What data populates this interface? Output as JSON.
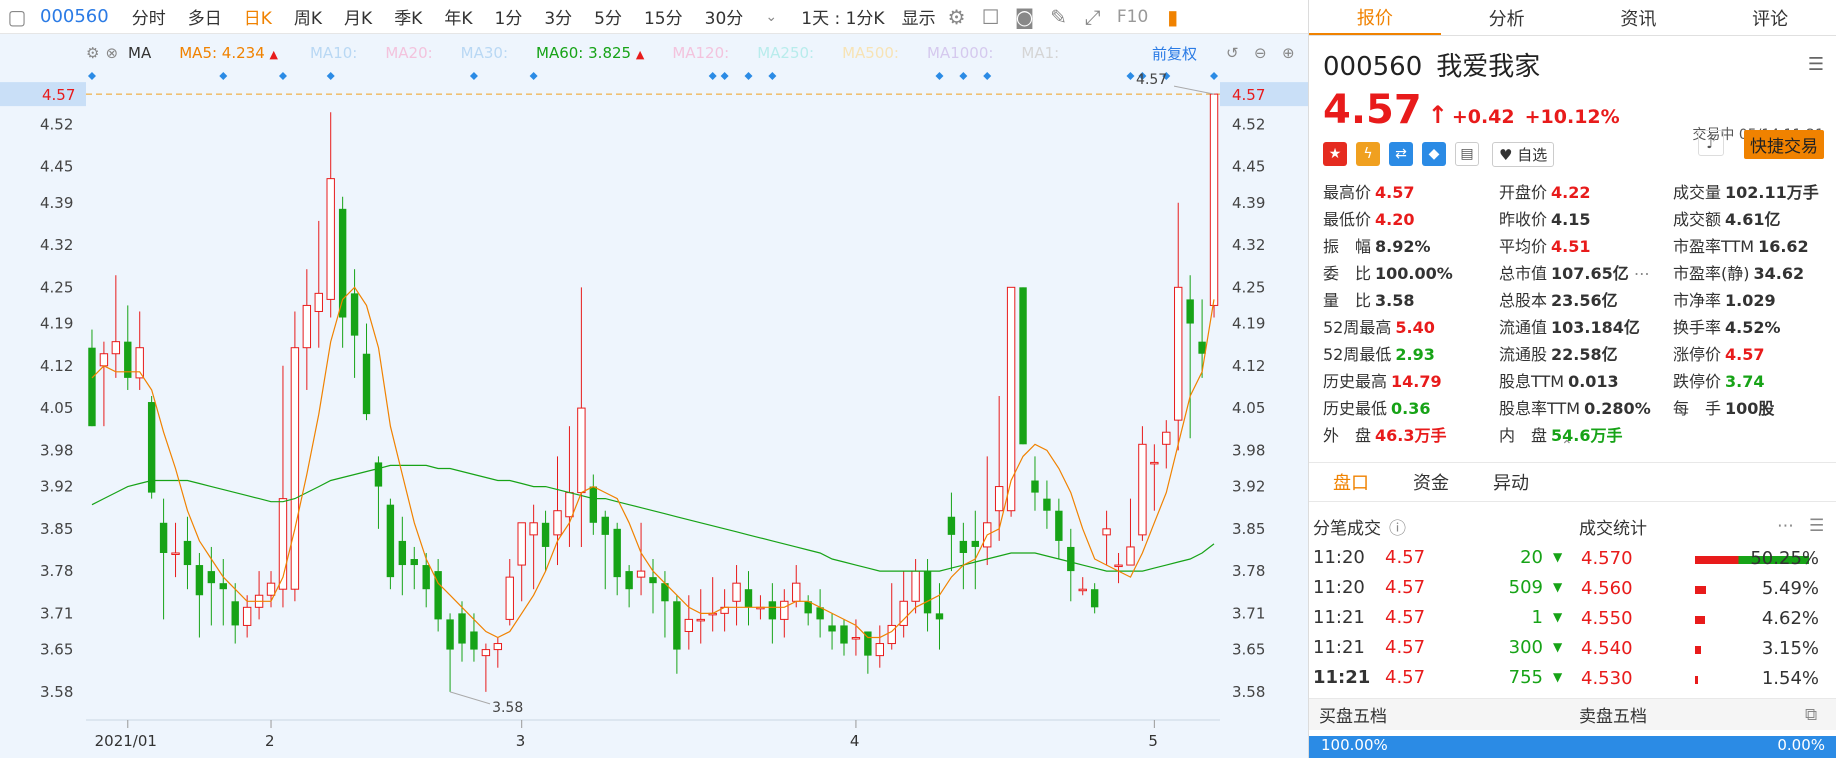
{
  "toolbar": {
    "code": "000560",
    "tabs": [
      "分时",
      "多日",
      "日K",
      "周K",
      "月K",
      "季K",
      "年K",
      "1分",
      "3分",
      "5分",
      "15分",
      "30分"
    ],
    "active_tab": "日K",
    "speed": "1天 : 1分K",
    "display": "显示",
    "f10": "F10"
  },
  "ma_line": {
    "label": "MA",
    "items": [
      {
        "name": "MA5: 4.234",
        "color": "#f08200",
        "arrow": "▲"
      },
      {
        "name": "MA10:",
        "color": "#b9d8f4"
      },
      {
        "name": "MA20:",
        "color": "#f3c3dd"
      },
      {
        "name": "MA30:",
        "color": "#b9d8f4"
      },
      {
        "name": "MA60: 3.825",
        "color": "#17a317",
        "arrow": "▲"
      },
      {
        "name": "MA120:",
        "color": "#f3c3dd"
      },
      {
        "name": "MA250:",
        "color": "#b8ecec"
      },
      {
        "name": "MA500:",
        "color": "#f7e3b5"
      },
      {
        "name": "MA1000:",
        "color": "#d5c9ee"
      },
      {
        "name": "MA1:",
        "color": "#d5d5d5"
      }
    ],
    "fq": "前复权"
  },
  "chart_data": {
    "type": "candlestick",
    "y_ticks": [
      "4.52",
      "4.45",
      "4.39",
      "4.32",
      "4.25",
      "4.19",
      "4.12",
      "4.05",
      "3.98",
      "3.92",
      "3.85",
      "3.78",
      "3.71",
      "3.65",
      "3.58"
    ],
    "ylim": [
      3.54,
      4.6
    ],
    "current_price_label": "4.57",
    "high_annotation": "4.57",
    "low_annotation": "3.58",
    "x_labels": [
      "2021/01",
      "2",
      "3",
      "4",
      "5"
    ],
    "candles": [
      [
        4.15,
        4.02,
        4.18,
        4.02
      ],
      [
        4.12,
        4.14,
        4.16,
        4.02
      ],
      [
        4.14,
        4.16,
        4.27,
        4.1
      ],
      [
        4.16,
        4.1,
        4.22,
        4.08
      ],
      [
        4.1,
        4.15,
        4.21,
        4.08
      ],
      [
        4.06,
        3.91,
        4.07,
        3.9
      ],
      [
        3.86,
        3.81,
        3.9,
        3.7
      ],
      [
        3.81,
        3.81,
        3.86,
        3.77
      ],
      [
        3.83,
        3.79,
        3.87,
        3.75
      ],
      [
        3.79,
        3.74,
        3.81,
        3.67
      ],
      [
        3.78,
        3.76,
        3.82,
        3.69
      ],
      [
        3.76,
        3.75,
        3.8,
        3.69
      ],
      [
        3.73,
        3.69,
        3.76,
        3.66
      ],
      [
        3.69,
        3.72,
        3.74,
        3.67
      ],
      [
        3.72,
        3.74,
        3.78,
        3.7
      ],
      [
        3.74,
        3.76,
        3.78,
        3.72
      ],
      [
        3.75,
        3.9,
        4.12,
        3.72
      ],
      [
        3.75,
        4.15,
        4.21,
        3.73
      ],
      [
        4.15,
        4.22,
        4.28,
        4.08
      ],
      [
        4.21,
        4.24,
        4.36,
        4.15
      ],
      [
        4.23,
        4.43,
        4.54,
        4.2
      ],
      [
        4.38,
        4.2,
        4.4,
        4.15
      ],
      [
        4.24,
        4.17,
        4.28,
        4.1
      ],
      [
        4.14,
        4.04,
        4.19,
        4.03
      ],
      [
        3.96,
        3.92,
        3.97,
        3.85
      ],
      [
        3.89,
        3.77,
        3.9,
        3.75
      ],
      [
        3.83,
        3.79,
        3.87,
        3.74
      ],
      [
        3.8,
        3.79,
        3.82,
        3.75
      ],
      [
        3.79,
        3.75,
        3.81,
        3.72
      ],
      [
        3.78,
        3.7,
        3.8,
        3.68
      ],
      [
        3.7,
        3.65,
        3.71,
        3.58
      ],
      [
        3.71,
        3.66,
        3.73,
        3.63
      ],
      [
        3.68,
        3.65,
        3.71,
        3.63
      ],
      [
        3.64,
        3.65,
        3.66,
        3.58
      ],
      [
        3.65,
        3.66,
        3.67,
        3.62
      ],
      [
        3.7,
        3.77,
        3.8,
        3.69
      ],
      [
        3.79,
        3.86,
        3.86,
        3.73
      ],
      [
        3.84,
        3.86,
        3.89,
        3.75
      ],
      [
        3.86,
        3.82,
        3.88,
        3.78
      ],
      [
        3.84,
        3.88,
        3.97,
        3.79
      ],
      [
        3.87,
        3.91,
        4.02,
        3.82
      ],
      [
        3.91,
        4.05,
        4.25,
        3.82
      ],
      [
        3.92,
        3.86,
        3.94,
        3.84
      ],
      [
        3.87,
        3.84,
        3.88,
        3.75
      ],
      [
        3.85,
        3.77,
        3.86,
        3.74
      ],
      [
        3.78,
        3.75,
        3.79,
        3.72
      ],
      [
        3.77,
        3.78,
        3.86,
        3.74
      ],
      [
        3.77,
        3.76,
        3.8,
        3.71
      ],
      [
        3.76,
        3.73,
        3.78,
        3.67
      ],
      [
        3.73,
        3.65,
        3.74,
        3.61
      ],
      [
        3.68,
        3.7,
        3.74,
        3.65
      ],
      [
        3.7,
        3.7,
        3.75,
        3.66
      ],
      [
        3.71,
        3.71,
        3.77,
        3.68
      ],
      [
        3.71,
        3.72,
        3.75,
        3.68
      ],
      [
        3.73,
        3.76,
        3.79,
        3.69
      ],
      [
        3.75,
        3.72,
        3.78,
        3.69
      ],
      [
        3.72,
        3.72,
        3.74,
        3.7
      ],
      [
        3.73,
        3.7,
        3.76,
        3.66
      ],
      [
        3.7,
        3.73,
        3.75,
        3.67
      ],
      [
        3.73,
        3.76,
        3.79,
        3.72
      ],
      [
        3.73,
        3.71,
        3.74,
        3.69
      ],
      [
        3.72,
        3.7,
        3.75,
        3.67
      ],
      [
        3.69,
        3.68,
        3.71,
        3.65
      ],
      [
        3.69,
        3.66,
        3.7,
        3.64
      ],
      [
        3.67,
        3.67,
        3.7,
        3.64
      ],
      [
        3.68,
        3.64,
        3.68,
        3.61
      ],
      [
        3.64,
        3.66,
        3.69,
        3.62
      ],
      [
        3.66,
        3.69,
        3.76,
        3.65
      ],
      [
        3.69,
        3.73,
        3.78,
        3.67
      ],
      [
        3.73,
        3.78,
        3.8,
        3.71
      ],
      [
        3.78,
        3.71,
        3.8,
        3.68
      ],
      [
        3.71,
        3.7,
        3.76,
        3.65
      ],
      [
        3.87,
        3.84,
        3.91,
        3.78
      ],
      [
        3.83,
        3.81,
        3.86,
        3.75
      ],
      [
        3.83,
        3.82,
        3.88,
        3.75
      ],
      [
        3.82,
        3.86,
        3.97,
        3.79
      ],
      [
        3.88,
        3.92,
        4.07,
        3.83
      ],
      [
        3.88,
        4.25,
        4.25,
        3.87
      ],
      [
        4.25,
        3.99,
        4.25,
        3.99
      ],
      [
        3.93,
        3.91,
        3.97,
        3.88
      ],
      [
        3.9,
        3.88,
        3.93,
        3.85
      ],
      [
        3.88,
        3.83,
        3.9,
        3.8
      ],
      [
        3.82,
        3.78,
        3.85,
        3.73
      ],
      [
        3.75,
        3.75,
        3.77,
        3.74
      ],
      [
        3.75,
        3.72,
        3.76,
        3.71
      ],
      [
        3.84,
        3.85,
        3.88,
        3.79
      ],
      [
        3.79,
        3.79,
        3.81,
        3.76
      ],
      [
        3.79,
        3.82,
        3.9,
        3.79
      ],
      [
        3.84,
        3.99,
        4.02,
        3.83
      ],
      [
        3.96,
        3.96,
        3.99,
        3.88
      ],
      [
        3.99,
        4.01,
        4.03,
        3.95
      ],
      [
        4.03,
        4.25,
        4.39,
        3.98
      ],
      [
        4.23,
        4.19,
        4.27,
        4.0
      ],
      [
        4.16,
        4.14,
        4.23,
        4.1
      ],
      [
        4.22,
        4.57,
        4.57,
        4.2
      ]
    ],
    "ma5": [
      4.1,
      4.12,
      4.11,
      4.11,
      4.11,
      4.08,
      4.01,
      3.95,
      3.88,
      3.83,
      3.8,
      3.77,
      3.75,
      3.73,
      3.73,
      3.73,
      3.77,
      3.85,
      3.94,
      4.04,
      4.16,
      4.23,
      4.25,
      4.22,
      4.15,
      4.02,
      3.94,
      3.86,
      3.8,
      3.76,
      3.74,
      3.72,
      3.7,
      3.68,
      3.67,
      3.68,
      3.71,
      3.74,
      3.78,
      3.83,
      3.86,
      3.91,
      3.92,
      3.91,
      3.9,
      3.86,
      3.81,
      3.78,
      3.76,
      3.74,
      3.72,
      3.71,
      3.71,
      3.72,
      3.72,
      3.72,
      3.72,
      3.72,
      3.72,
      3.73,
      3.73,
      3.72,
      3.71,
      3.7,
      3.69,
      3.67,
      3.67,
      3.68,
      3.7,
      3.72,
      3.73,
      3.74,
      3.77,
      3.79,
      3.8,
      3.84,
      3.85,
      3.93,
      3.97,
      3.99,
      3.98,
      3.95,
      3.91,
      3.85,
      3.8,
      3.79,
      3.78,
      3.77,
      3.81,
      3.86,
      3.91,
      3.99,
      4.07,
      4.11,
      4.23
    ],
    "ma60_desc": "smooth green line from ~3.89 rising to ~3.96 (early Feb), declining to ~3.78 (April), ending ~3.82",
    "ma60": [
      3.89,
      3.9,
      3.91,
      3.92,
      3.925,
      3.93,
      3.93,
      3.93,
      3.93,
      3.925,
      3.92,
      3.915,
      3.91,
      3.905,
      3.9,
      3.895,
      3.895,
      3.9,
      3.91,
      3.92,
      3.93,
      3.935,
      3.94,
      3.945,
      3.95,
      3.955,
      3.955,
      3.955,
      3.955,
      3.95,
      3.95,
      3.945,
      3.94,
      3.935,
      3.93,
      3.93,
      3.925,
      3.92,
      3.92,
      3.915,
      3.91,
      3.905,
      3.9,
      3.9,
      3.895,
      3.89,
      3.885,
      3.88,
      3.875,
      3.87,
      3.865,
      3.86,
      3.855,
      3.85,
      3.845,
      3.84,
      3.835,
      3.83,
      3.825,
      3.82,
      3.815,
      3.81,
      3.8,
      3.795,
      3.79,
      3.785,
      3.78,
      3.78,
      3.78,
      3.78,
      3.78,
      3.78,
      3.785,
      3.79,
      3.795,
      3.8,
      3.805,
      3.81,
      3.81,
      3.81,
      3.805,
      3.8,
      3.795,
      3.79,
      3.785,
      3.78,
      3.78,
      3.78,
      3.78,
      3.785,
      3.79,
      3.795,
      3.8,
      3.81,
      3.825
    ]
  },
  "right": {
    "tabs": [
      "报价",
      "分析",
      "资讯",
      "评论"
    ],
    "code": "000560",
    "name": "我爱我家",
    "price": "4.57",
    "arrow": "↑",
    "change": "+0.42",
    "pct": "+10.12%",
    "status": "交易中 05/14 11:21",
    "zixuan": "自选",
    "quick_trade": "快捷交易",
    "stats": [
      {
        "l": "最高价",
        "v": "4.57",
        "c": "red"
      },
      {
        "l": "开盘价",
        "v": "4.22",
        "c": "red"
      },
      {
        "l": "成交量",
        "v": "102.11万手",
        "c": "blk"
      },
      {
        "l": "最低价",
        "v": "4.20",
        "c": "red"
      },
      {
        "l": "昨收价",
        "v": "4.15",
        "c": "blk"
      },
      {
        "l": "成交额",
        "v": "4.61亿",
        "c": "blk"
      },
      {
        "l": "振　幅",
        "v": "8.92%",
        "c": "blk"
      },
      {
        "l": "平均价",
        "v": "4.51",
        "c": "red"
      },
      {
        "l": "市盈率TTM",
        "v": "16.62",
        "c": "blk"
      },
      {
        "l": "委　比",
        "v": "100.00%",
        "c": "blk"
      },
      {
        "l": "总市值",
        "v": "107.65亿",
        "c": "blk"
      },
      {
        "l": "市盈率(静)",
        "v": "34.62",
        "c": "blk"
      },
      {
        "l": "量　比",
        "v": "3.58",
        "c": "blk"
      },
      {
        "l": "总股本",
        "v": "23.56亿",
        "c": "blk"
      },
      {
        "l": "市净率",
        "v": "1.029",
        "c": "blk"
      },
      {
        "l": "52周最高",
        "v": "5.40",
        "c": "red"
      },
      {
        "l": "流通值",
        "v": "103.184亿",
        "c": "blk"
      },
      {
        "l": "换手率",
        "v": "4.52%",
        "c": "blk"
      },
      {
        "l": "52周最低",
        "v": "2.93",
        "c": "green"
      },
      {
        "l": "流通股",
        "v": "22.58亿",
        "c": "blk"
      },
      {
        "l": "涨停价",
        "v": "4.57",
        "c": "red"
      },
      {
        "l": "历史最高",
        "v": "14.79",
        "c": "red"
      },
      {
        "l": "股息TTM",
        "v": "0.013",
        "c": "blk"
      },
      {
        "l": "跌停价",
        "v": "3.74",
        "c": "green"
      },
      {
        "l": "历史最低",
        "v": "0.36",
        "c": "green"
      },
      {
        "l": "股息率TTM",
        "v": "0.280%",
        "c": "blk"
      },
      {
        "l": "每　手",
        "v": "100股",
        "c": "blk"
      },
      {
        "l": "外　盘",
        "v": "46.3万手",
        "c": "red"
      },
      {
        "l": "内　盘",
        "v": "54.6万手",
        "c": "green"
      }
    ],
    "section_tabs": [
      "盘口",
      "资金",
      "异动"
    ],
    "ticks_title": "分笔成交",
    "stats_title": "成交统计",
    "ticks": [
      {
        "t": "11:20",
        "p": "4.57",
        "v": "20"
      },
      {
        "t": "11:20",
        "p": "4.57",
        "v": "509"
      },
      {
        "t": "11:21",
        "p": "4.57",
        "v": "1"
      },
      {
        "t": "11:21",
        "p": "4.57",
        "v": "300"
      },
      {
        "t": "11:21",
        "p": "4.57",
        "v": "755"
      }
    ],
    "dist": [
      {
        "p": "4.570",
        "pct": "50.25%",
        "w": 0.95
      },
      {
        "p": "4.560",
        "pct": "5.49%",
        "w": 0.09
      },
      {
        "p": "4.550",
        "pct": "4.62%",
        "w": 0.08
      },
      {
        "p": "4.540",
        "pct": "3.15%",
        "w": 0.05
      },
      {
        "p": "4.530",
        "pct": "1.54%",
        "w": 0.025
      }
    ],
    "buy5": "买盘五档",
    "sell5": "卖盘五档",
    "bar_left": "100.00%",
    "bar_right": "0.00%"
  }
}
